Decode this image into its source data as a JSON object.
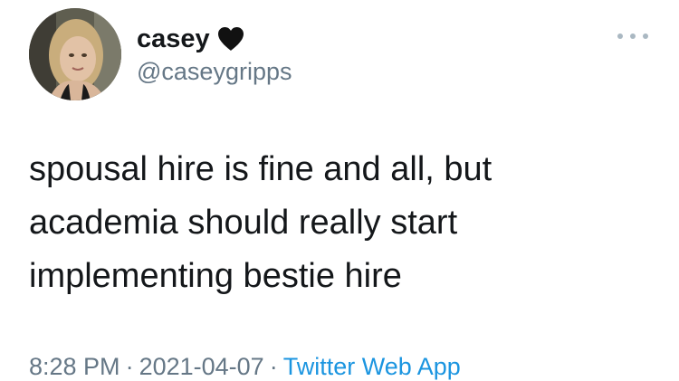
{
  "tweet": {
    "author": {
      "display_name": "casey",
      "handle": "@caseygripps",
      "avatar_icon": "profile-photo",
      "name_emoji": "black-heart-icon"
    },
    "text_lines": [
      "spousal hire is fine and all, but",
      "academia should really start",
      "implementing bestie hire"
    ],
    "time": "8:28 PM",
    "separator": "·",
    "date": "2021-04-07",
    "source": "Twitter Web App",
    "menu_icon": "more-options-icon"
  },
  "colors": {
    "text": "#14171a",
    "secondary": "#657786",
    "link": "#1b95e0",
    "menu_dots": "#aab8c2"
  }
}
